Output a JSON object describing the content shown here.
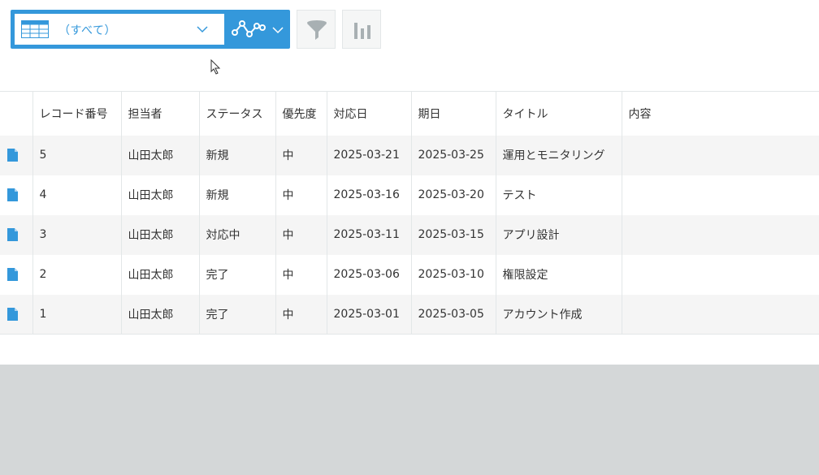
{
  "toolbar": {
    "view_label": "（すべて）",
    "icons": {
      "view": "table-view-icon",
      "graph": "line-graph-icon",
      "filter": "filter-icon",
      "chart": "bar-chart-icon",
      "chevron": "chevron-down-icon"
    }
  },
  "colors": {
    "accent": "#3498db",
    "row_alt": "#f5f5f5",
    "page_bg": "#d4d7d8"
  },
  "table": {
    "headers": [
      "レコード番号",
      "担当者",
      "ステータス",
      "優先度",
      "対応日",
      "期日",
      "タイトル",
      "内容"
    ],
    "rows": [
      [
        "5",
        "山田太郎",
        "新規",
        "中",
        "2025-03-21",
        "2025-03-25",
        "運用とモニタリング",
        ""
      ],
      [
        "4",
        "山田太郎",
        "新規",
        "中",
        "2025-03-16",
        "2025-03-20",
        "テスト",
        ""
      ],
      [
        "3",
        "山田太郎",
        "対応中",
        "中",
        "2025-03-11",
        "2025-03-15",
        "アプリ設計",
        ""
      ],
      [
        "2",
        "山田太郎",
        "完了",
        "中",
        "2025-03-06",
        "2025-03-10",
        "権限設定",
        ""
      ],
      [
        "1",
        "山田太郎",
        "完了",
        "中",
        "2025-03-01",
        "2025-03-05",
        "アカウント作成",
        ""
      ]
    ]
  }
}
